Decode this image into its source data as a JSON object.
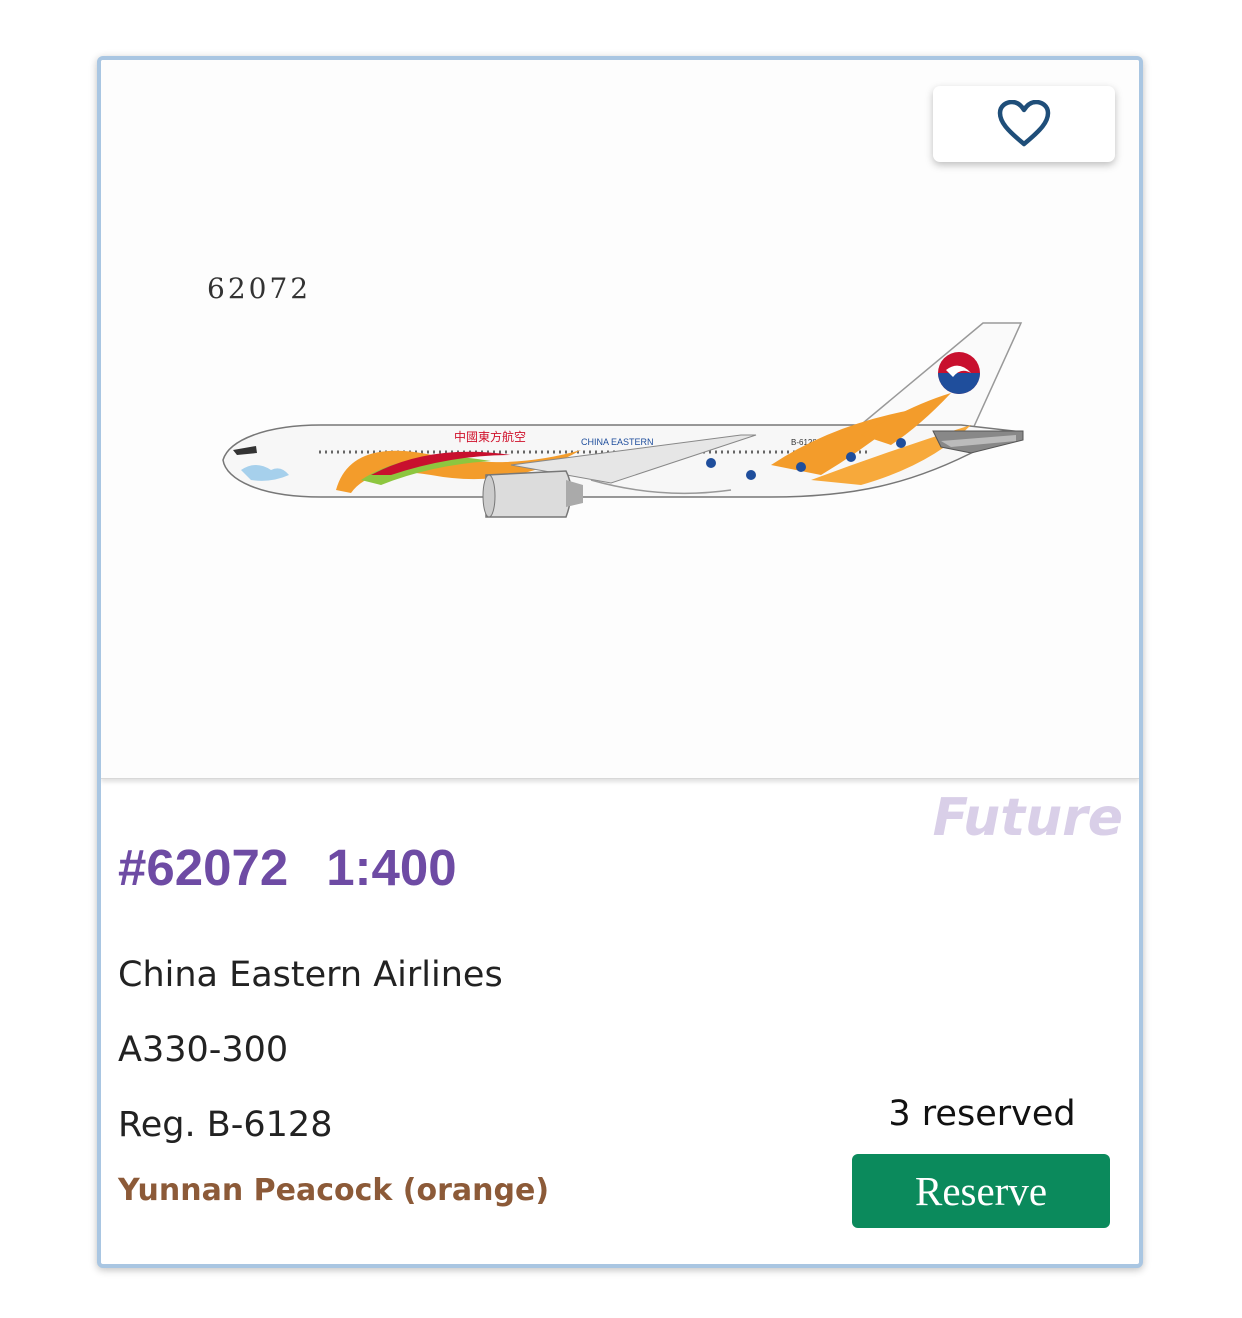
{
  "favorite": {
    "icon": "heart-icon"
  },
  "product": {
    "image_label": "62072",
    "status": "Future",
    "code": "#62072",
    "scale": "1:400",
    "airline": "China Eastern Airlines",
    "aircraft": "A330-300",
    "registration": "Reg. B-6128",
    "livery": "Yunnan Peacock (orange)"
  },
  "reservation": {
    "count_text": "3 reserved",
    "button_label": "Reserve"
  },
  "aircraft_image": {
    "titles_cn": "中國東方航空",
    "titles_en": "CHINA EASTERN",
    "reg_on_fuselage": "B-6128"
  },
  "colors": {
    "card_border": "#a9c6e2",
    "title_purple": "#6e4ba4",
    "status_lavender": "#d9cfe8",
    "livery_brown": "#8c5a38",
    "reserve_green": "#0b8a5c",
    "heart_blue": "#1f4e79"
  }
}
